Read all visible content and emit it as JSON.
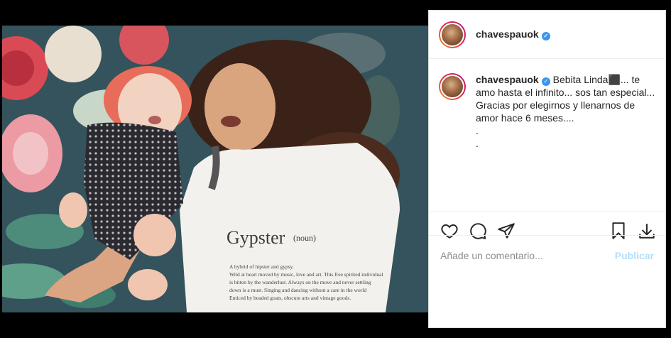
{
  "post": {
    "image_alt": "Mother and baby lying on floral fabric",
    "shirt_word": "Gypster",
    "shirt_pos": "(noun)",
    "shirt_lines": [
      "A hybrid of hipster and gypsy.",
      "Wild at heart moved by music, love and art. This free spirited individual",
      "is bitten by the wanderlust. Always on the move and never settling",
      "down is a must. Singing and dancing without a care in the world",
      "Enticed by beaded goats, obscure arts and vintage goods."
    ]
  },
  "header": {
    "username": "chavespauok",
    "verified_icon": "verified-badge-icon"
  },
  "caption": {
    "username": "chavespauok",
    "text": "Bebita Linda⬛... te amo hasta el infinito... sos tan especial... Gracias por elegirnos y llenarnos de amor hace 6 meses....",
    "dot1": ".",
    "dot2": "."
  },
  "actions": {
    "like_icon": "heart-icon",
    "comment_icon": "comment-icon",
    "share_icon": "share-icon",
    "save_icon": "bookmark-icon",
    "download_icon": "download-icon"
  },
  "comment_box": {
    "placeholder": "Añade un comentario...",
    "value": "",
    "publish_label": "Publicar"
  },
  "colors": {
    "verified": "#3897f0",
    "publish_disabled": "#b2dffc",
    "username": "#262626"
  }
}
